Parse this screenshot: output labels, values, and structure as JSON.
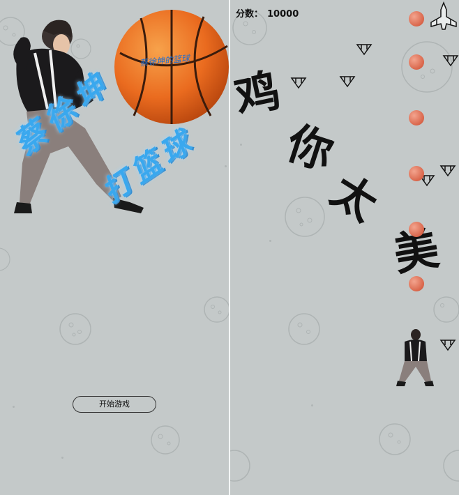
{
  "start_screen": {
    "start_button_label": "开始游戏",
    "title_line1": "蔡徐坤",
    "title_line2": "打篮球",
    "ball_logo_text": "蔡徐坤的篮球"
  },
  "game_screen": {
    "score_label": "分数：",
    "score_value": "10000",
    "taunt_chars": [
      "鸡",
      "你",
      "太",
      "美"
    ]
  },
  "colors": {
    "background": "#c4c9c9",
    "title_blue": "#3aa8ee",
    "ball_orange": "#e8682a",
    "bullet": "#d9654a"
  },
  "icons": [
    "player-figure-icon",
    "basketball-icon",
    "enemy-fighter-icon",
    "player-ship-icon"
  ]
}
